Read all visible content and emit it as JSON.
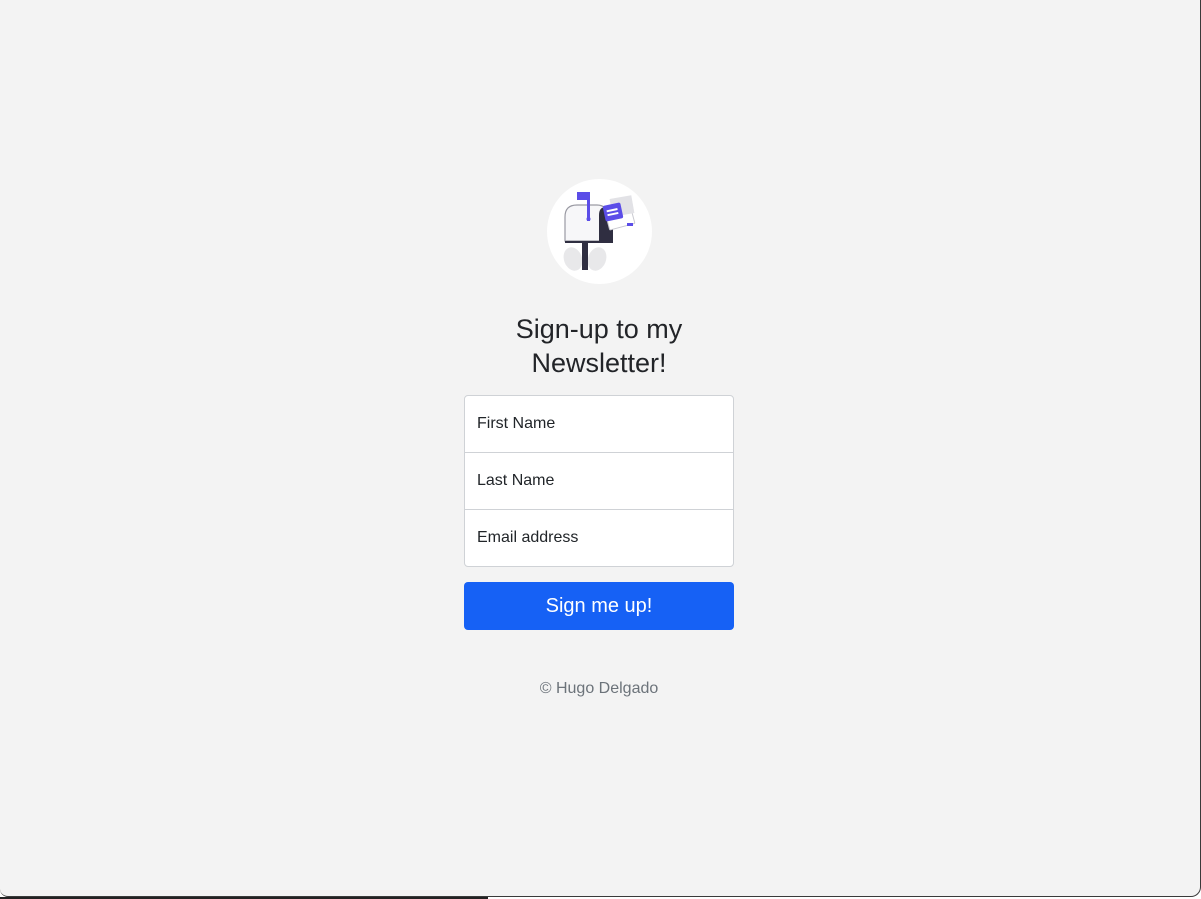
{
  "heading": "Sign-up to my Newsletter!",
  "form": {
    "first_name_placeholder": "First Name",
    "last_name_placeholder": "Last Name",
    "email_placeholder": "Email address",
    "submit_label": "Sign me up!"
  },
  "footer": {
    "copyright": "© Hugo Delgado"
  },
  "logo": {
    "icon": "mailbox-icon"
  },
  "colors": {
    "page_background": "#f3f3f3",
    "button": "#1661f5",
    "accent_purple": "#5b4de8",
    "dark_post": "#2f2e41"
  }
}
